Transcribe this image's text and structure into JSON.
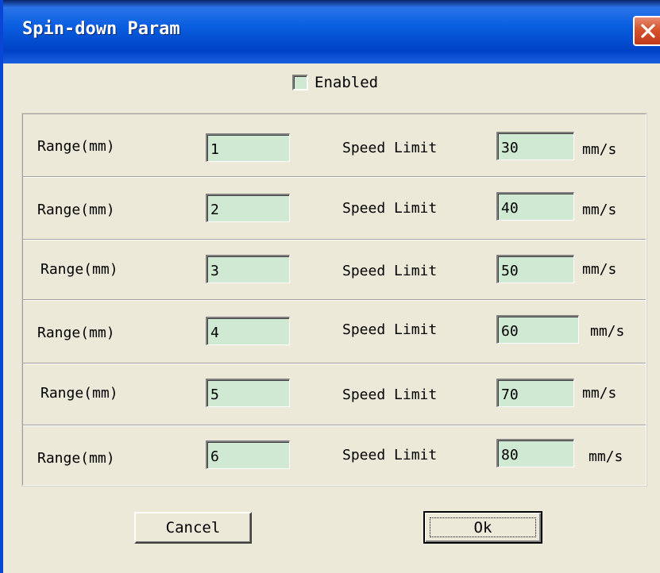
{
  "window": {
    "title": "Spin-down Param",
    "close_icon": "close-icon",
    "accent_color": "#0a5fe0",
    "close_color": "#d5532f"
  },
  "enabled": {
    "label": "Enabled",
    "checked": false,
    "fill_color": "#cfe9d3"
  },
  "rows": [
    {
      "range_label": "Range(mm)",
      "range_value": "1",
      "speed_label": "Speed Limit",
      "speed_value": "30",
      "unit": "mm/s"
    },
    {
      "range_label": "Range(mm)",
      "range_value": "2",
      "speed_label": "Speed Limit",
      "speed_value": "40",
      "unit": "mm/s"
    },
    {
      "range_label": "Range(mm)",
      "range_value": "3",
      "speed_label": "Speed Limit",
      "speed_value": "50",
      "unit": "mm/s"
    },
    {
      "range_label": "Range(mm)",
      "range_value": "4",
      "speed_label": "Speed Limit",
      "speed_value": "60",
      "unit": "mm/s"
    },
    {
      "range_label": "Range(mm)",
      "range_value": "5",
      "speed_label": "Speed Limit",
      "speed_value": "70",
      "unit": "mm/s"
    },
    {
      "range_label": "Range(mm)",
      "range_value": "6",
      "speed_label": "Speed Limit",
      "speed_value": "80",
      "unit": "mm/s"
    }
  ],
  "buttons": {
    "cancel_label": "Cancel",
    "ok_label": "Ok"
  }
}
